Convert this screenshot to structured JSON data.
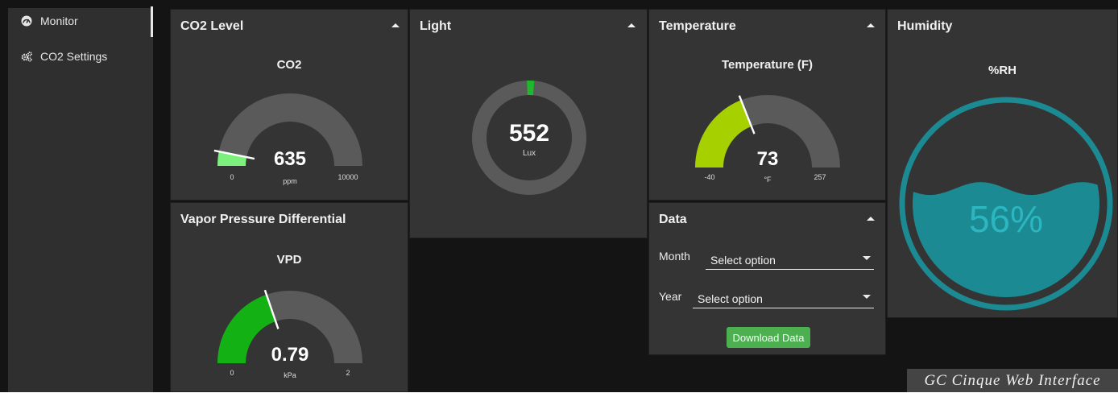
{
  "sidebar": {
    "items": [
      {
        "label": "Monitor",
        "icon": "dashboard-icon",
        "active": true
      },
      {
        "label": "CO2 Settings",
        "icon": "cogs-icon",
        "active": false
      }
    ]
  },
  "cards": {
    "co2": {
      "header": "CO2 Level",
      "gauge": {
        "title": "CO2",
        "value": 635,
        "value_text": "635",
        "unit": "ppm",
        "min": 0,
        "max": 10000,
        "min_label": "0",
        "max_label": "10000",
        "fill_color": "#7cf07c"
      }
    },
    "light": {
      "header": "Light",
      "donut": {
        "value": 552,
        "value_text": "552",
        "unit": "Lux",
        "fill_color": "#1db82c"
      }
    },
    "temperature": {
      "header": "Temperature",
      "gauge": {
        "title": "Temperature (F)",
        "value": 73,
        "value_text": "73",
        "unit": "°F",
        "min": -40,
        "max": 257,
        "min_label": "-40",
        "max_label": "257",
        "fill_color": "#a6d000"
      }
    },
    "humidity": {
      "header": "Humidity",
      "gauge": {
        "title": "%RH",
        "value": 56,
        "value_text": "56%",
        "color": "#1b8a93",
        "text_color": "#2bb6c0"
      }
    },
    "vpd": {
      "header": "Vapor Pressure Differential",
      "gauge": {
        "title": "VPD",
        "value": 0.79,
        "value_text": "0.79",
        "unit": "kPa",
        "min": 0,
        "max": 2,
        "min_label": "0",
        "max_label": "2",
        "fill_color": "#13b113"
      }
    },
    "data": {
      "header": "Data",
      "month_label": "Month",
      "month_value": "Select option",
      "year_label": "Year",
      "year_value": "Select option",
      "download_label": "Download Data"
    }
  },
  "caption": "GC Cinque Web Interface"
}
